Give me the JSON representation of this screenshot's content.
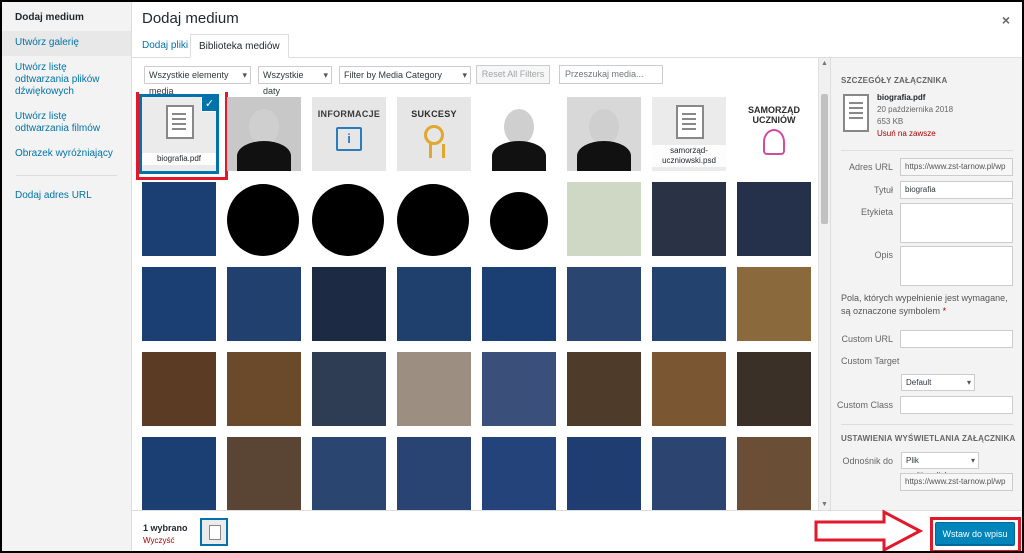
{
  "menu": {
    "heading": "Dodaj medium",
    "items": [
      {
        "label": "Utwórz galerię"
      },
      {
        "label": "Utwórz listę odtwarzania plików dźwiękowych"
      },
      {
        "label": "Utwórz listę odtwarzania filmów"
      },
      {
        "label": "Obrazek wyróżniający"
      }
    ],
    "add_url": "Dodaj adres URL"
  },
  "title": "Dodaj medium",
  "close": "×",
  "tabs": [
    {
      "label": "Dodaj pliki",
      "active": false
    },
    {
      "label": "Biblioteka mediów",
      "active": true
    }
  ],
  "toolbar": {
    "filter_type": "Wszystkie elementy media",
    "filter_date": "Wszystkie daty",
    "filter_category": "Filter by Media Category",
    "reset": "Reset All Filters",
    "search_placeholder": "Przeszukaj media..."
  },
  "grid": {
    "tiles": [
      {
        "kind": "doc",
        "name": "biografia.pdf",
        "selected": true
      },
      {
        "kind": "portrait"
      },
      {
        "kind": "info",
        "label": "INFORMACJE"
      },
      {
        "kind": "medal",
        "label": "SUKCESY"
      },
      {
        "kind": "portrait"
      },
      {
        "kind": "portrait"
      },
      {
        "kind": "doc",
        "name": "samorząd-uczniowski.psd"
      },
      {
        "kind": "samorzad",
        "label": "SAMORZĄD UCZNIÓW"
      }
    ]
  },
  "details": {
    "heading": "SZCZEGÓŁY ZAŁĄCZNIKA",
    "filename": "biografia.pdf",
    "date": "20 października 2018",
    "size": "653 KB",
    "delete": "Usuń na zawsze",
    "url_label": "Adres URL",
    "url_value": "https://www.zst-tarnow.pl/wp",
    "title_label": "Tytuł",
    "title_value": "biografia",
    "caption_label": "Etykieta",
    "desc_label": "Opis",
    "required_note": "Pola, których wypełnienie jest wymagane, są oznaczone symbolem",
    "required_star": "*",
    "custom_url_label": "Custom URL",
    "custom_target_label": "Custom Target",
    "custom_target_value": "Default",
    "custom_class_label": "Custom Class",
    "display_heading": "USTAWIENIA WYŚWIETLANIA ZAŁĄCZNIKA",
    "link_to_label": "Odnośnik do",
    "link_to_value": "Plik multimedialny",
    "link_url_value": "https://www.zst-tarnow.pl/wp"
  },
  "footer": {
    "count": "1 wybrano",
    "clear": "Wyczyść",
    "insert": "Wstaw do wpisu"
  },
  "colors": {
    "accent": "#0073aa",
    "primary_button": "#0085ba",
    "annotation_red": "#e2182b"
  }
}
